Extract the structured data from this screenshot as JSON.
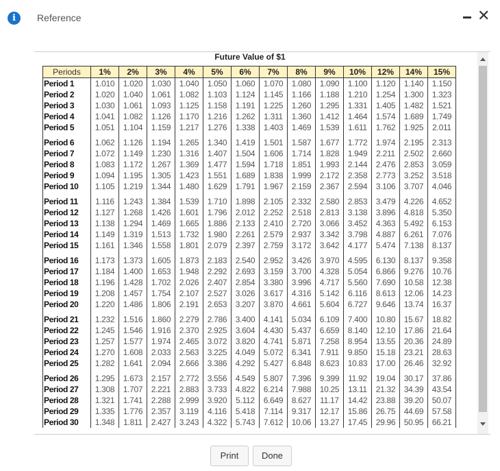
{
  "header": {
    "title": "Reference",
    "info_icon": "info-icon",
    "minimize_icon": "minimize-icon",
    "close_icon": "close-icon"
  },
  "table": {
    "title": "Future Value of $1",
    "columns": [
      "Periods",
      "1%",
      "2%",
      "3%",
      "4%",
      "5%",
      "6%",
      "7%",
      "8%",
      "9%",
      "10%",
      "12%",
      "14%",
      "15%"
    ],
    "rows": [
      [
        "Period 1",
        "1.010",
        "1.020",
        "1.030",
        "1.040",
        "1.050",
        "1.060",
        "1.070",
        "1.080",
        "1.090",
        "1.100",
        "1.120",
        "1.140",
        "1.150"
      ],
      [
        "Period 2",
        "1.020",
        "1.040",
        "1.061",
        "1.082",
        "1.103",
        "1.124",
        "1.145",
        "1.166",
        "1.188",
        "1.210",
        "1.254",
        "1.300",
        "1.323"
      ],
      [
        "Period 3",
        "1.030",
        "1.061",
        "1.093",
        "1.125",
        "1.158",
        "1.191",
        "1.225",
        "1.260",
        "1.295",
        "1.331",
        "1.405",
        "1.482",
        "1.521"
      ],
      [
        "Period 4",
        "1.041",
        "1.082",
        "1.126",
        "1.170",
        "1.216",
        "1.262",
        "1.311",
        "1.360",
        "1.412",
        "1.464",
        "1.574",
        "1.689",
        "1.749"
      ],
      [
        "Period 5",
        "1.051",
        "1.104",
        "1.159",
        "1.217",
        "1.276",
        "1.338",
        "1.403",
        "1.469",
        "1.539",
        "1.611",
        "1.762",
        "1.925",
        "2.011"
      ],
      [
        "Period 6",
        "1.062",
        "1.126",
        "1.194",
        "1.265",
        "1.340",
        "1.419",
        "1.501",
        "1.587",
        "1.677",
        "1.772",
        "1.974",
        "2.195",
        "2.313"
      ],
      [
        "Period 7",
        "1.072",
        "1.149",
        "1.230",
        "1.316",
        "1.407",
        "1.504",
        "1.606",
        "1.714",
        "1.828",
        "1.949",
        "2.211",
        "2.502",
        "2.660"
      ],
      [
        "Period 8",
        "1.083",
        "1.172",
        "1.267",
        "1.369",
        "1.477",
        "1.594",
        "1.718",
        "1.851",
        "1.993",
        "2.144",
        "2.476",
        "2.853",
        "3.059"
      ],
      [
        "Period 9",
        "1.094",
        "1.195",
        "1.305",
        "1.423",
        "1.551",
        "1.689",
        "1.838",
        "1.999",
        "2.172",
        "2.358",
        "2.773",
        "3.252",
        "3.518"
      ],
      [
        "Period 10",
        "1.105",
        "1.219",
        "1.344",
        "1.480",
        "1.629",
        "1.791",
        "1.967",
        "2.159",
        "2.367",
        "2.594",
        "3.106",
        "3.707",
        "4.046"
      ],
      [
        "Period 11",
        "1.116",
        "1.243",
        "1.384",
        "1.539",
        "1.710",
        "1.898",
        "2.105",
        "2.332",
        "2.580",
        "2.853",
        "3.479",
        "4.226",
        "4.652"
      ],
      [
        "Period 12",
        "1.127",
        "1.268",
        "1.426",
        "1.601",
        "1.796",
        "2.012",
        "2.252",
        "2.518",
        "2.813",
        "3.138",
        "3.896",
        "4.818",
        "5.350"
      ],
      [
        "Period 13",
        "1.138",
        "1.294",
        "1.469",
        "1.665",
        "1.886",
        "2.133",
        "2.410",
        "2.720",
        "3.066",
        "3.452",
        "4.363",
        "5.492",
        "6.153"
      ],
      [
        "Period 14",
        "1.149",
        "1.319",
        "1.513",
        "1.732",
        "1.980",
        "2.261",
        "2.579",
        "2.937",
        "3.342",
        "3.798",
        "4.887",
        "6.261",
        "7.076"
      ],
      [
        "Period 15",
        "1.161",
        "1.346",
        "1.558",
        "1.801",
        "2.079",
        "2.397",
        "2.759",
        "3.172",
        "3.642",
        "4.177",
        "5.474",
        "7.138",
        "8.137"
      ],
      [
        "Period 16",
        "1.173",
        "1.373",
        "1.605",
        "1.873",
        "2.183",
        "2.540",
        "2.952",
        "3.426",
        "3.970",
        "4.595",
        "6.130",
        "8.137",
        "9.358"
      ],
      [
        "Period 17",
        "1.184",
        "1.400",
        "1.653",
        "1.948",
        "2.292",
        "2.693",
        "3.159",
        "3.700",
        "4.328",
        "5.054",
        "6.866",
        "9.276",
        "10.76"
      ],
      [
        "Period 18",
        "1.196",
        "1.428",
        "1.702",
        "2.026",
        "2.407",
        "2.854",
        "3.380",
        "3.996",
        "4.717",
        "5.560",
        "7.690",
        "10.58",
        "12.38"
      ],
      [
        "Period 19",
        "1.208",
        "1.457",
        "1.754",
        "2.107",
        "2.527",
        "3.026",
        "3.617",
        "4.316",
        "5.142",
        "6.116",
        "8.613",
        "12.06",
        "14.23"
      ],
      [
        "Period 20",
        "1.220",
        "1.486",
        "1.806",
        "2.191",
        "2.653",
        "3.207",
        "3.870",
        "4.661",
        "5.604",
        "6.727",
        "9.646",
        "13.74",
        "16.37"
      ],
      [
        "Period 21",
        "1.232",
        "1.516",
        "1.860",
        "2.279",
        "2.786",
        "3.400",
        "4.141",
        "5.034",
        "6.109",
        "7.400",
        "10.80",
        "15.67",
        "18.82"
      ],
      [
        "Period 22",
        "1.245",
        "1.546",
        "1.916",
        "2.370",
        "2.925",
        "3.604",
        "4.430",
        "5.437",
        "6.659",
        "8.140",
        "12.10",
        "17.86",
        "21.64"
      ],
      [
        "Period 23",
        "1.257",
        "1.577",
        "1.974",
        "2.465",
        "3.072",
        "3.820",
        "4.741",
        "5.871",
        "7.258",
        "8.954",
        "13.55",
        "20.36",
        "24.89"
      ],
      [
        "Period 24",
        "1.270",
        "1.608",
        "2.033",
        "2.563",
        "3.225",
        "4.049",
        "5.072",
        "6.341",
        "7.911",
        "9.850",
        "15.18",
        "23.21",
        "28.63"
      ],
      [
        "Period 25",
        "1.282",
        "1.641",
        "2.094",
        "2.666",
        "3.386",
        "4.292",
        "5.427",
        "6.848",
        "8.623",
        "10.83",
        "17.00",
        "26.46",
        "32.92"
      ],
      [
        "Period 26",
        "1.295",
        "1.673",
        "2.157",
        "2.772",
        "3.556",
        "4.549",
        "5.807",
        "7.396",
        "9.399",
        "11.92",
        "19.04",
        "30.17",
        "37.86"
      ],
      [
        "Period 27",
        "1.308",
        "1.707",
        "2.221",
        "2.883",
        "3.733",
        "4.822",
        "6.214",
        "7.988",
        "10.25",
        "13.11",
        "21.32",
        "34.39",
        "43.54"
      ],
      [
        "Period 28",
        "1.321",
        "1.741",
        "2.288",
        "2.999",
        "3.920",
        "5.112",
        "6.649",
        "8.627",
        "11.17",
        "14.42",
        "23.88",
        "39.20",
        "50.07"
      ],
      [
        "Period 29",
        "1.335",
        "1.776",
        "2.357",
        "3.119",
        "4.116",
        "5.418",
        "7.114",
        "9.317",
        "12.17",
        "15.86",
        "26.75",
        "44.69",
        "57.58"
      ],
      [
        "Period 30",
        "1.348",
        "1.811",
        "2.427",
        "3.243",
        "4.322",
        "5.743",
        "7.612",
        "10.06",
        "13.27",
        "17.45",
        "29.96",
        "50.95",
        "66.21"
      ]
    ]
  },
  "buttons": {
    "print": "Print",
    "done": "Done"
  },
  "colors": {
    "header_bg": "#fff3c4",
    "info_blue": "#1a73c8"
  }
}
